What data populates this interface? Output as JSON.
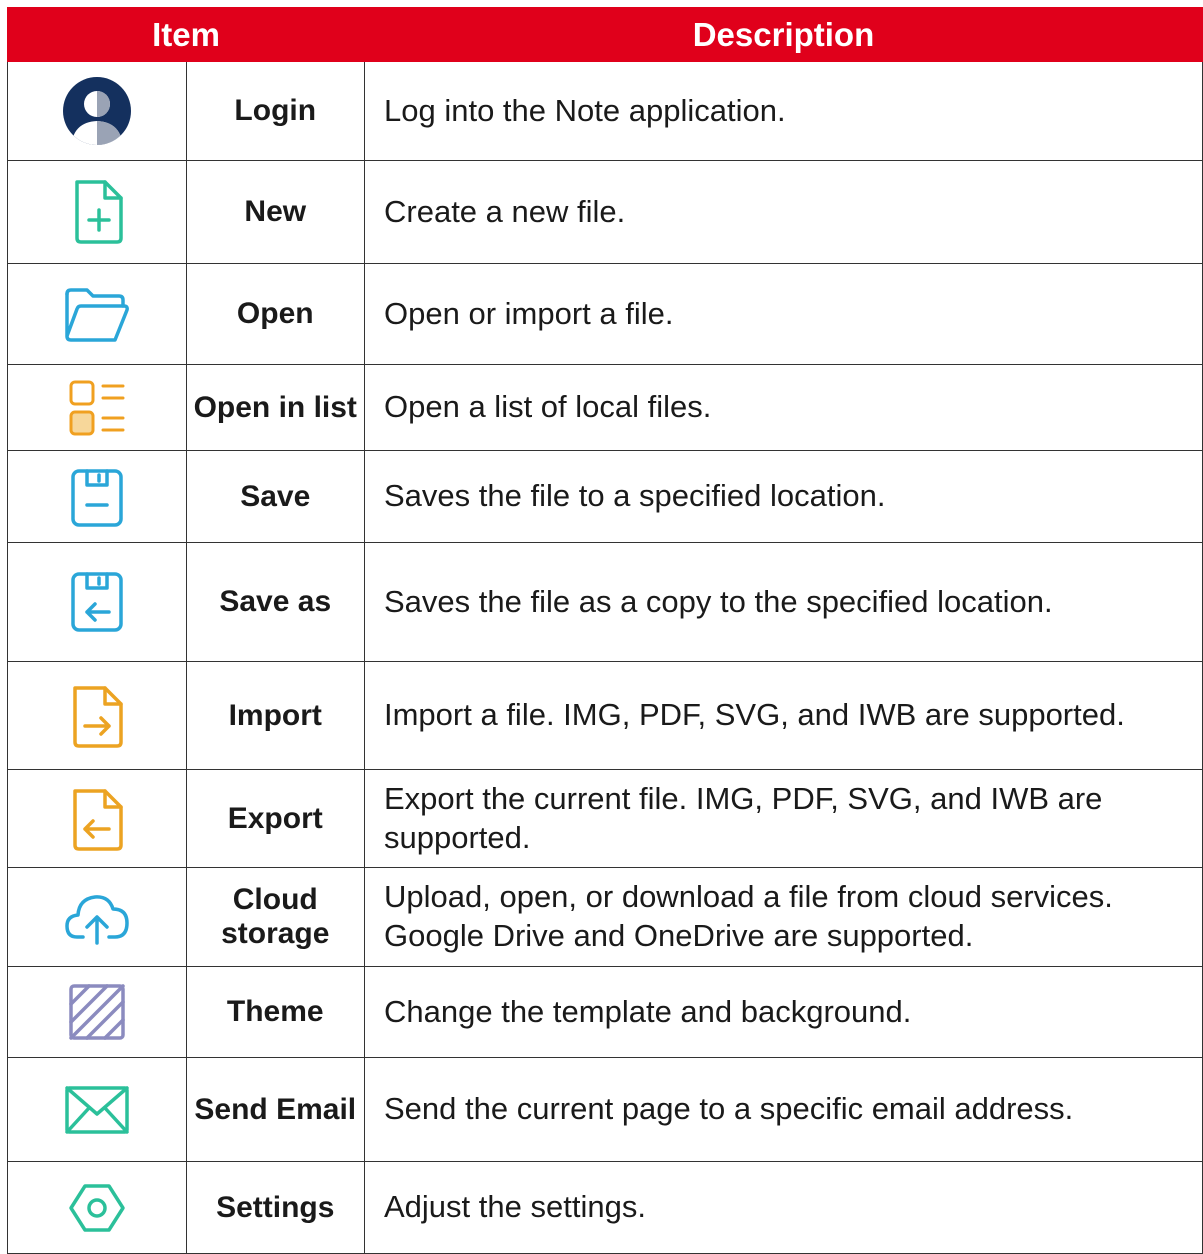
{
  "header": {
    "item_label": "Item",
    "description_label": "Description",
    "header_color": "#e0001b"
  },
  "rows": [
    {
      "icon": "login-avatar-icon",
      "name": "Login",
      "description": "Log into the Note application."
    },
    {
      "icon": "new-file-icon",
      "name": "New",
      "description": "Create a new file."
    },
    {
      "icon": "open-folder-icon",
      "name": "Open",
      "description": "Open or import a file."
    },
    {
      "icon": "open-in-list-icon",
      "name": "Open in list",
      "description": "Open a list of local files."
    },
    {
      "icon": "save-icon",
      "name": "Save",
      "description": "Saves the file to a specified location."
    },
    {
      "icon": "save-as-icon",
      "name": "Save as",
      "description": "Saves the file as a copy to the specified location."
    },
    {
      "icon": "import-icon",
      "name": "Import",
      "description": "Import a file. IMG, PDF, SVG, and IWB are supported."
    },
    {
      "icon": "export-icon",
      "name": "Export",
      "description": "Export the current file. IMG, PDF, SVG, and IWB are supported."
    },
    {
      "icon": "cloud-storage-icon",
      "name": "Cloud storage",
      "description": "Upload, open, or download a file from cloud services. Google Drive and OneDrive are supported."
    },
    {
      "icon": "theme-icon",
      "name": "Theme",
      "description": "Change the template and background."
    },
    {
      "icon": "send-email-icon",
      "name": "Send Email",
      "description": "Send the current page to a specific email address."
    },
    {
      "icon": "settings-icon",
      "name": "Settings",
      "description": "Adjust the settings."
    }
  ]
}
